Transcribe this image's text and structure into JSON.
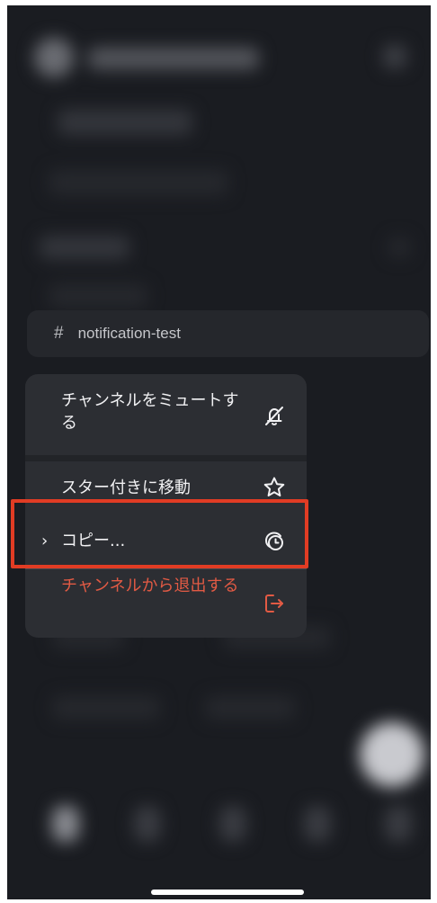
{
  "channel": {
    "hash": "#",
    "name": "notification-test"
  },
  "menu": {
    "items": [
      {
        "label": "チャンネルをミュートする",
        "icon": "bell-slash-icon"
      },
      {
        "label": "スター付きに移動",
        "icon": "star-icon"
      },
      {
        "label": "コピー...",
        "icon": "copy-icon",
        "chevron": "›"
      },
      {
        "label": "チャンネルから退出する",
        "icon": "leave-icon"
      }
    ]
  },
  "colors": {
    "background": "#1a1c21",
    "menu_bg": "#2c2e33",
    "destructive": "#e25a44",
    "highlight": "#e13c24"
  }
}
